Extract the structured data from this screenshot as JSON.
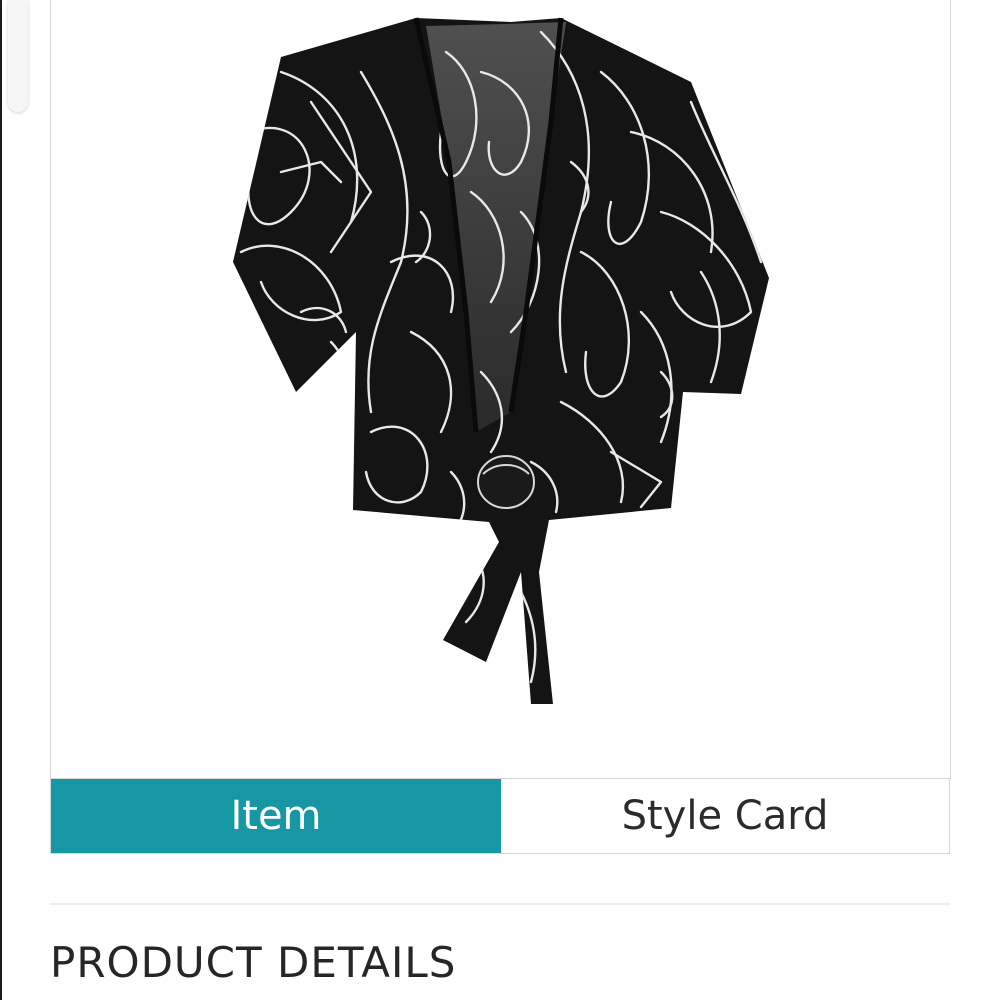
{
  "tabs": {
    "item_label": "Item",
    "style_card_label": "Style Card",
    "active": "Item"
  },
  "product_details": {
    "heading": "PRODUCT DETAILS"
  },
  "colors": {
    "accent": "#1797a3",
    "text": "#262626",
    "border": "#d5d5d5"
  }
}
